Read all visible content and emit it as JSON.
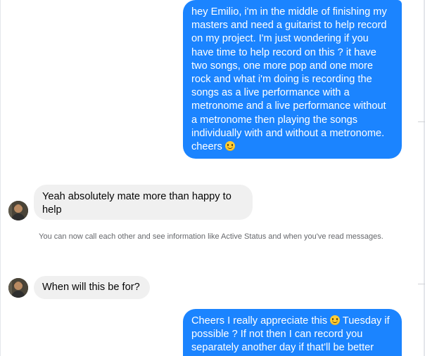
{
  "messages": [
    {
      "direction": "outgoing",
      "text": "hey Emilio, i'm in the middle of finishing my masters and need a guitarist to help record on my project. I'm just wondering if you have time to help record on this ? it have two songs, one more pop and one more rock and what i'm doing is recording the songs as a live performance with a metronome and a live performance without a metronome then playing the songs individually with and without a metronome.",
      "tail": "cheers",
      "emoji": "slightly-smiling-face"
    },
    {
      "direction": "incoming",
      "text": "Yeah absolutely mate more than happy to help"
    },
    {
      "direction": "system",
      "text": "You can now call each other and see information like Active Status and when you've read messages."
    },
    {
      "direction": "incoming",
      "text": "When will this be for?"
    },
    {
      "direction": "outgoing",
      "text_before_emoji": "Cheers I really appreciate this",
      "emoji": "slightly-smiling-face",
      "text_after_emoji": "Tuesday if possible ? If not then I can record you separately another day if that'll be better"
    }
  ],
  "colors": {
    "outgoing_bubble": "#1b84ff",
    "incoming_bubble": "#f0f0f0",
    "system_text": "#65676b"
  }
}
